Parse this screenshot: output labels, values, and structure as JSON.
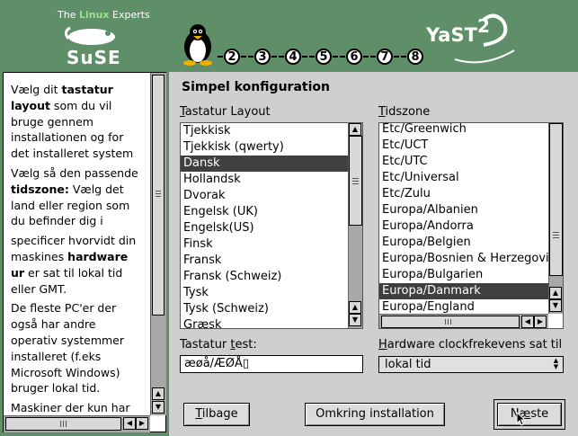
{
  "header": {
    "tagline_prefix": "The ",
    "tagline_highlight": "Linux",
    "tagline_suffix": " Experts",
    "brand": "SuSE",
    "product": "YaST",
    "steps": [
      "2",
      "3",
      "4",
      "5",
      "6",
      "7",
      "8"
    ]
  },
  "help": {
    "paragraphs": [
      [
        "Vælg dit ",
        "tastatur layout",
        " som du vil bruge gennem installationen og for det installeret system"
      ],
      [
        "Vælg så den passende ",
        "tidszone:",
        " Vælg det land eller region som du befinder dig i"
      ],
      [
        "specificer hvorvidt din maskines ",
        "hardware ur",
        " er sat til lokal tid eller GMT."
      ],
      [
        "De fleste PC'er der også har andre operativ systemmer installeret (f.eks Microsoft Windows) bruger lokal tid.",
        "",
        ""
      ],
      [
        "Maskiner der kun har",
        "",
        ""
      ]
    ]
  },
  "main": {
    "title": "Simpel konfiguration",
    "keyboard_label_u": "T",
    "keyboard_label_rest": "astatur Layout",
    "keyboard_items": [
      "Tjekkisk",
      "Tjekkisk (qwerty)",
      "Dansk",
      "Hollandsk",
      "Dvorak",
      "Engelsk (UK)",
      "Engelsk(US)",
      "Finsk",
      "Fransk",
      "Fransk (Schweiz)",
      "Tysk",
      "Tysk (Schweiz)",
      "Græsk"
    ],
    "keyboard_selected": "Dansk",
    "timezone_label_u": "T",
    "timezone_label_rest": "idszone",
    "timezone_items": [
      "Etc/Greenwich",
      "Etc/UCT",
      "Etc/UTC",
      "Etc/Universal",
      "Etc/Zulu",
      "Europa/Albanien",
      "Europa/Andorra",
      "Europa/Belgien",
      "Europa/Bosnien & Herzegovi",
      "Europa/Bulgarien",
      "Europa/Danmark",
      "Europa/England"
    ],
    "timezone_selected": "Europa/Danmark",
    "test_label_pre": "Tastatur ",
    "test_label_u": "t",
    "test_label_rest": "est:",
    "test_value": "æøå/ÆØÅ▯",
    "clock_label_u": "H",
    "clock_label_rest": "ardware clockfrekevens sat til",
    "clock_value": "lokal tid"
  },
  "buttons": {
    "back_u": "T",
    "back_rest": "ilbage",
    "abort": "Omkring installation",
    "next_pre": "N",
    "next_u": "æ",
    "next_rest": "ste"
  }
}
